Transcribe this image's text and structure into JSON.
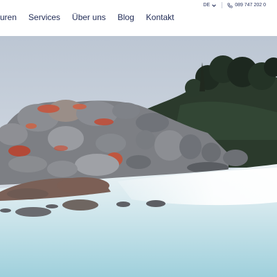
{
  "header": {
    "nav": [
      {
        "label": "nturen"
      },
      {
        "label": "Services"
      },
      {
        "label": "Über uns"
      },
      {
        "label": "Blog"
      },
      {
        "label": "Kontakt"
      }
    ],
    "language": "DE",
    "phone": "089 747 202 0"
  },
  "hero": {
    "image_description": "Coastal scene with orange-lichen covered granite boulders, trees and misty turquoise water"
  },
  "colors": {
    "nav_text": "#1f2a55",
    "sky": "#c9d3df",
    "water": "#b7dbe3",
    "lichen": "#c8523a"
  }
}
